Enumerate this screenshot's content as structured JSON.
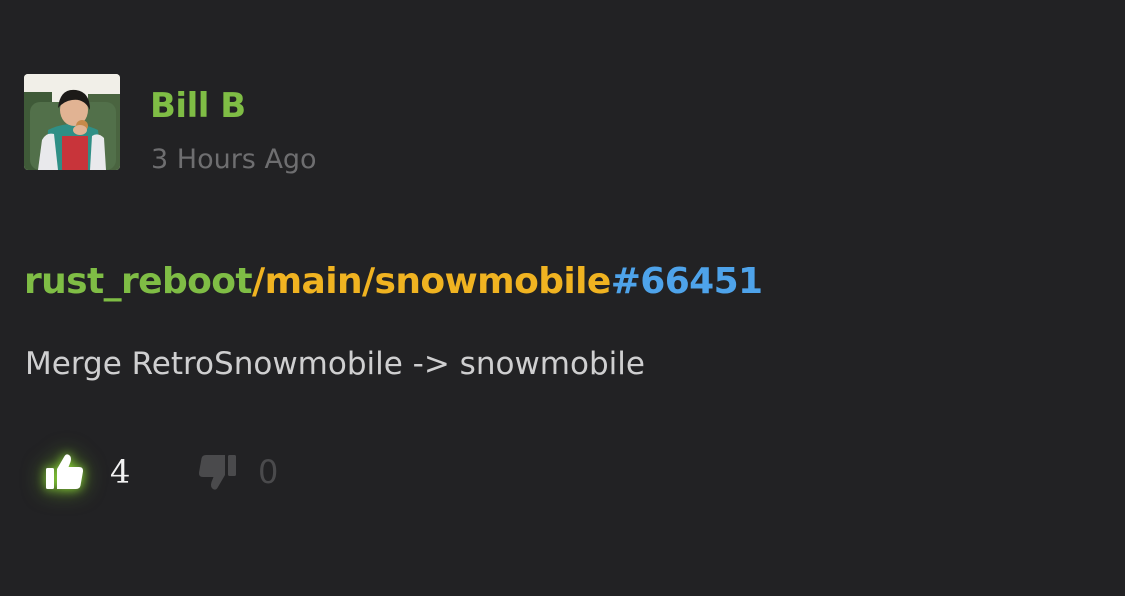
{
  "post": {
    "author": "Bill B",
    "timestamp": "3 Hours Ago",
    "commit": {
      "repo": "rust_reboot",
      "branch": "/main/snowmobile",
      "changeset": "#66451"
    },
    "message": "Merge RetroSnowmobile -> snowmobile",
    "votes": {
      "up_icon": "thumbs-up-icon",
      "up_count": "4",
      "down_icon": "thumbs-down-icon",
      "down_count": "0"
    }
  },
  "colors": {
    "background": "#222224",
    "author": "#7fbd45",
    "repo": "#7fbd45",
    "branch": "#f0b321",
    "changeset": "#4ea3ea",
    "message": "#cfcfd0",
    "timestamp": "#6e6e70",
    "upvote_glow": "#96e63c",
    "downvote_muted": "#4a4a4c"
  }
}
